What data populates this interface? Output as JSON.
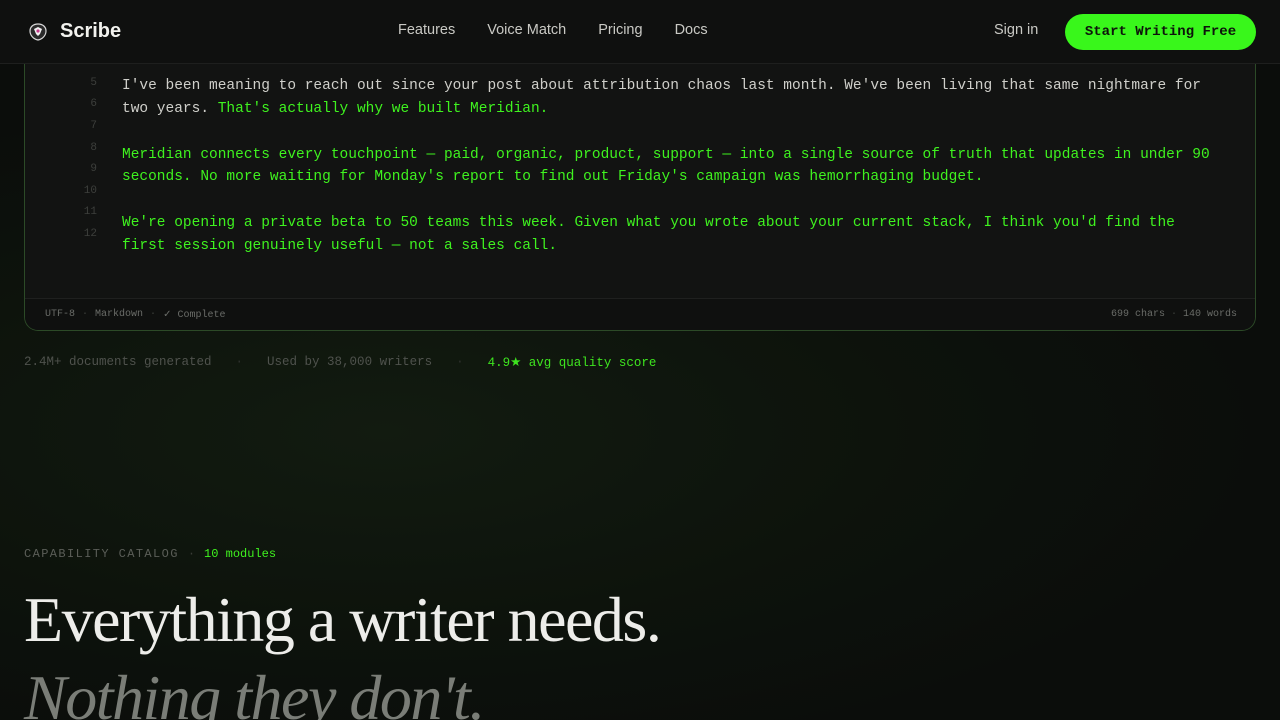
{
  "nav": {
    "brand": "Scribe",
    "links": [
      "Features",
      "Voice Match",
      "Pricing",
      "Docs"
    ],
    "signin": "Sign in",
    "cta": "Start Writing Free"
  },
  "editor": {
    "line_numbers": [
      "5",
      "6",
      "7",
      "8",
      "9",
      "10",
      "11",
      "12"
    ],
    "para1_plain": "I've been meaning to reach out since your post about attribution chaos last month. We've been living that same nightmare for two years.",
    "para1_green": "That's actually why we built Meridian.",
    "para2": "Meridian connects every touchpoint — paid, organic, product, support — into a single source of truth that updates in under 90 seconds. No more waiting for Monday's report to find out Friday's campaign was hemorrhaging budget.",
    "para3": "We're opening a private beta to 50 teams this week. Given what you wrote about your current stack, I think you'd find the first session genuinely useful — not a sales call.",
    "status": {
      "encoding": "UTF-8",
      "format": "Markdown",
      "state": "✓ Complete",
      "chars": "699 chars",
      "words": "140 words"
    }
  },
  "stats": {
    "docs": "2.4M+ documents generated",
    "writers": "Used by 38,000 writers",
    "score": "4.9★ avg quality score"
  },
  "catalog": {
    "eyebrow": "CAPABILITY CATALOG",
    "count": "10 modules",
    "headline": "Everything a writer needs.",
    "headline_italic": "Nothing they don't."
  },
  "colors": {
    "accent": "#39f71b",
    "background": "#0b0d0b"
  }
}
